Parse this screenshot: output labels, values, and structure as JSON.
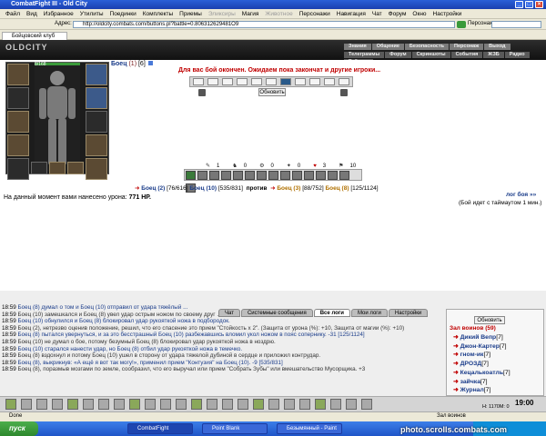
{
  "window": {
    "title": "CombatFight III - Old City"
  },
  "menu": {
    "items": [
      "Файл",
      "Вид",
      "Избранное",
      "Утилиты",
      "Поединки",
      "Комплекты",
      "Приемы",
      "Эликсиры",
      "Магия",
      "Животное",
      "Персонажи",
      "Навигация",
      "Чат",
      "Форум",
      "Окно",
      "Настройки"
    ],
    "disabled": [
      "Эликсиры",
      "Животное"
    ]
  },
  "address": {
    "label": "Адрес:",
    "url": "http://oldcity.combats.com/buttons.pl?battle=0.806312629481O9",
    "pers_label": "Персонаж:"
  },
  "tab": {
    "label": "Бойцовский клуб"
  },
  "game": {
    "logo": "OLDCITY",
    "topnav": [
      "Знания",
      "Общение",
      "Безопасность",
      "Персонаж",
      "Выход"
    ],
    "subnav": [
      "Телеграммы",
      "Форум",
      "Скриншоты",
      "События",
      "ЖЗБ",
      "Радио",
      "Рейтинг"
    ]
  },
  "fighter": {
    "name": "Боец",
    "level": "(1)",
    "bracket": "[6]",
    "hp": "8/168"
  },
  "battle": {
    "status": "Для вас бой окончен. Ожидаем пока закончат и другие игроки...",
    "refresh_btn": "Обновить",
    "counters": [
      "1",
      "0",
      "0",
      "0",
      "3",
      "10"
    ],
    "team1": [
      {
        "name": "Боец (2)",
        "hp": "[76/616]"
      },
      {
        "name": "Боец (10)",
        "hp": "[535/831]"
      }
    ],
    "versus": "против",
    "team2": [
      {
        "name": "Боец (3)",
        "hp": "[88/752]"
      },
      {
        "name": "Боец (8)",
        "hp": "[125/1124]"
      }
    ],
    "damage_label": "На данный момент вами нанесено урона:",
    "damage_value": "771 HP.",
    "log_link": "лог боя »»",
    "timeout_text": "(Бой идет с таймаутом 1 мин.)"
  },
  "chat": {
    "tabs": [
      "Чат",
      "Системные сообщения",
      "Все логи",
      "Мои логи",
      "Настройки"
    ],
    "active_tab": "Все логи",
    "lines": [
      {
        "t": "18:59",
        "text": "Боец (8) думал о том и Боец (10) отправил от удара тяжёлый ..."
      },
      {
        "t": "18:59",
        "text": "Боец (10) замешкался и Боец (8) увел удар острым ножом по своему друг ..."
      },
      {
        "t": "18:59",
        "text": "Боец (10) обнулился и Боец (8) блокировал удар рукояткой ножа в подбородок."
      },
      {
        "t": "18:59",
        "text": "Боец (2), нетрезво оценив положение, решил, что его спасение это прием \"Стойкость x 2\". (Защита от урона (%): +10, Защита от магии (%): +10)"
      },
      {
        "t": "18:59",
        "text": "Боец (8) пытался увернуться, и за это бесстрашный Боец (10) разбежавшись вломил укол ножом в пояс сопернику. -31 [125/1124]"
      },
      {
        "t": "18:59",
        "text": "Боец (10) не думал о бое, потому безумный Боец (8) блокировал удар рукояткой ножа в ноздрю."
      },
      {
        "t": "18:59",
        "text": "Боец (10) старался нанести удар, но Боец (8) отбил удар рукояткой ножа в темечко."
      },
      {
        "t": "18:59",
        "text": "Боец (8) вздохнул и потому Боец (10) ушел в сторону от удара тяжелой дубиной в сердце и приложил контрудар."
      },
      {
        "t": "18:59",
        "text": "Боец (8), выкрикнув: «А ещё я вот так могу!», применил прием \"Контузия\" на Боец (10). -9 [535/831]"
      },
      {
        "t": "18:59",
        "text": "Боец (8), поразмыв мозгами по земле, сообразил, что его выручал или прием \"Собрать Зубы\" или вмешательство Мусорщика. +3"
      }
    ]
  },
  "hall": {
    "refresh_btn": "Обновить",
    "title": "Зал воинов (59)",
    "players": [
      {
        "name": "Дикий Вепр",
        "lvl": "[7]"
      },
      {
        "name": "Джон-Картер",
        "lvl": "[7]"
      },
      {
        "name": "гном-ик",
        "lvl": "[7]"
      },
      {
        "name": "ДРОЗД",
        "lvl": "[7]"
      },
      {
        "name": "Кецалькоатль",
        "lvl": "[7]"
      },
      {
        "name": "зайчка",
        "lvl": "[7]"
      },
      {
        "name": "Журнал",
        "lvl": "[7]"
      },
      {
        "name": "Белая иномарка",
        "lvl": "[7]"
      }
    ]
  },
  "game_clock": "19:00",
  "status_bar": {
    "left": "Done",
    "right": "Зал воинов"
  },
  "status_bar_mid": "H: 1170M: 0",
  "taskbar": {
    "start": "пуск",
    "tasks": [
      "CombatFight",
      "Point Blank",
      "Безымянный - Paint"
    ],
    "watermark": "photo.scrolls.combats.com"
  }
}
